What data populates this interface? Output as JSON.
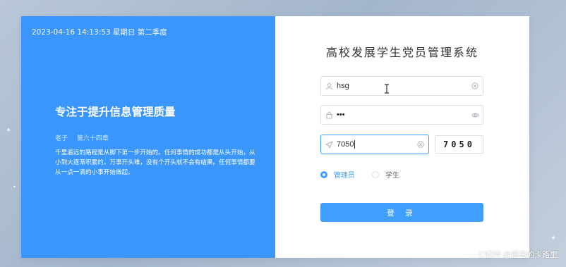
{
  "left_panel": {
    "datetime": "2023-04-16 14:13:53 星期日 第二季度",
    "slogan": "专注于提升信息管理质量",
    "author": {
      "name": "老子",
      "source": "第六十四章"
    },
    "quote": "千里遥远的路程是从脚下第一步开始的。任何事情的成功都是从头开始，从小到大逐渐积累的。万事开头难，没有个开头就不会有结果。任何事情都要从一点一滴的小事开始做起。"
  },
  "login": {
    "system_title": "高校发展学生党员管理系统",
    "username": {
      "value": "hsg",
      "icon": "user-icon",
      "suffix_icon": "clear-icon"
    },
    "password": {
      "value": "•••",
      "icon": "lock-icon",
      "suffix_icon": "eye-icon"
    },
    "code": {
      "value": "7050",
      "icon": "send-icon",
      "suffix_icon": "clear-icon"
    },
    "captcha": "7050",
    "roles": [
      {
        "label": "管理员",
        "checked": true
      },
      {
        "label": "学生",
        "checked": false
      }
    ],
    "login_button": "登 录"
  },
  "watermark": "CSDN @逃逸的卡路里",
  "colors": {
    "accent": "#409eff",
    "left_panel_bg": "#3a96fb"
  }
}
